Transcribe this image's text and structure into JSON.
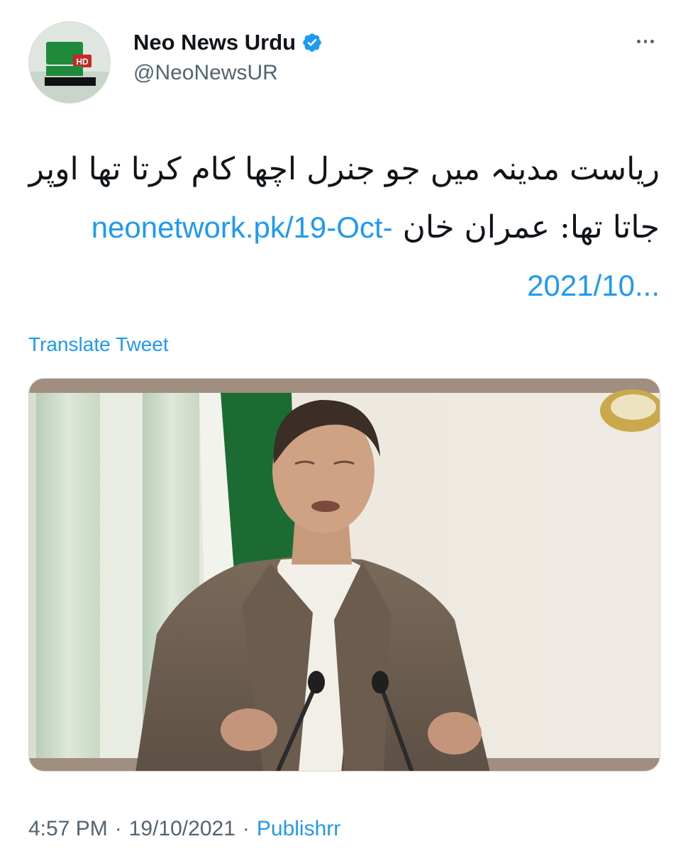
{
  "account": {
    "display_name": "Neo News Urdu",
    "handle": "@NeoNewsUR",
    "verified": true,
    "avatar_icon": "neo-news-logo-icon",
    "brand_color": "#2e7d32"
  },
  "tweet": {
    "text_urdu": "ریاست مدینہ میں جو جنرل اچھا کام کرتا تھا اوپر جاتا تھا: عمران خان",
    "link_text": "neonetwork.pk/19-Oct-2021/10...",
    "translate_label": "Translate Tweet",
    "link_color": "#1d9bf0"
  },
  "media": {
    "type": "photo"
  },
  "meta": {
    "time": "4:57 PM",
    "separator": "·",
    "date": "19/10/2021",
    "source": "Publishrr"
  },
  "icons": {
    "verified": "verified-badge-icon",
    "more": "more-options-icon"
  }
}
